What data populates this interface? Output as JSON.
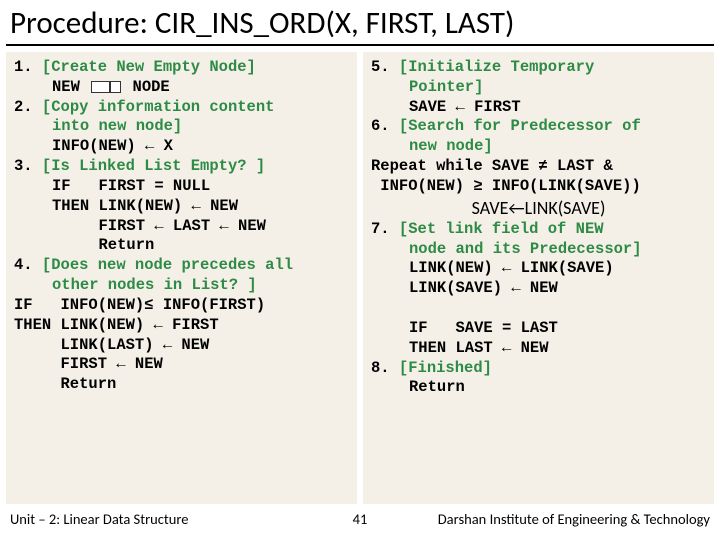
{
  "title": "Procedure: CIR_INS_ORD(X, FIRST, LAST)",
  "left": {
    "s1_num": "1.",
    "s1_title": "[Create New Empty Node]",
    "s1_l1a": "NEW ",
    "s1_l1b": " NODE",
    "s2_num": "2.",
    "s2_title": "[Copy information content",
    "s2_title2": "into new node]",
    "s2_l1": "INFO(NEW) ← X",
    "s3_num": "3.",
    "s3_title": "[Is Linked List Empty? ]",
    "s3_l1": "IF   FIRST = NULL",
    "s3_l2": "THEN LINK(NEW) ← NEW",
    "s3_l3": "     FIRST ← LAST ← NEW",
    "s3_l4": "     Return",
    "s4_num": "4.",
    "s4_title": "[Does new node precedes all",
    "s4_title2": "other nodes in List? ]",
    "s4_l1": "IF   INFO(NEW)≤ INFO(FIRST)",
    "s4_l2": "THEN LINK(NEW) ← FIRST",
    "s4_l3": "     LINK(LAST) ← NEW",
    "s4_l4": "     FIRST ← NEW",
    "s4_l5": "     Return"
  },
  "right": {
    "s5_num": "5.",
    "s5_title": "[Initialize Temporary",
    "s5_title2": "Pointer]",
    "s5_l1": "SAVE ← FIRST",
    "s6_num": "6.",
    "s6_title": "[Search for Predecessor of",
    "s6_title2": "new node]",
    "s6_l1": "Repeat while SAVE ≠ LAST &",
    "s6_l2": " INFO(NEW) ≥ INFO(LINK(SAVE))",
    "s6_l3": "SAVE←LINK(SAVE)",
    "s7_num": "7.",
    "s7_title": "[Set link field of NEW",
    "s7_title2": "node and its Predecessor]",
    "s7_l1": "LINK(NEW) ← LINK(SAVE)",
    "s7_l2": "LINK(SAVE) ← NEW",
    "s7_blank": " ",
    "s7_l3": "IF   SAVE = LAST",
    "s7_l4": "THEN LAST ← NEW",
    "s8_num": "8.",
    "s8_title": "[Finished]",
    "s8_l1": "Return"
  },
  "footer": {
    "left": "Unit – 2: Linear Data Structure",
    "mid": "41",
    "right": "Darshan Institute of Engineering & Technology"
  }
}
